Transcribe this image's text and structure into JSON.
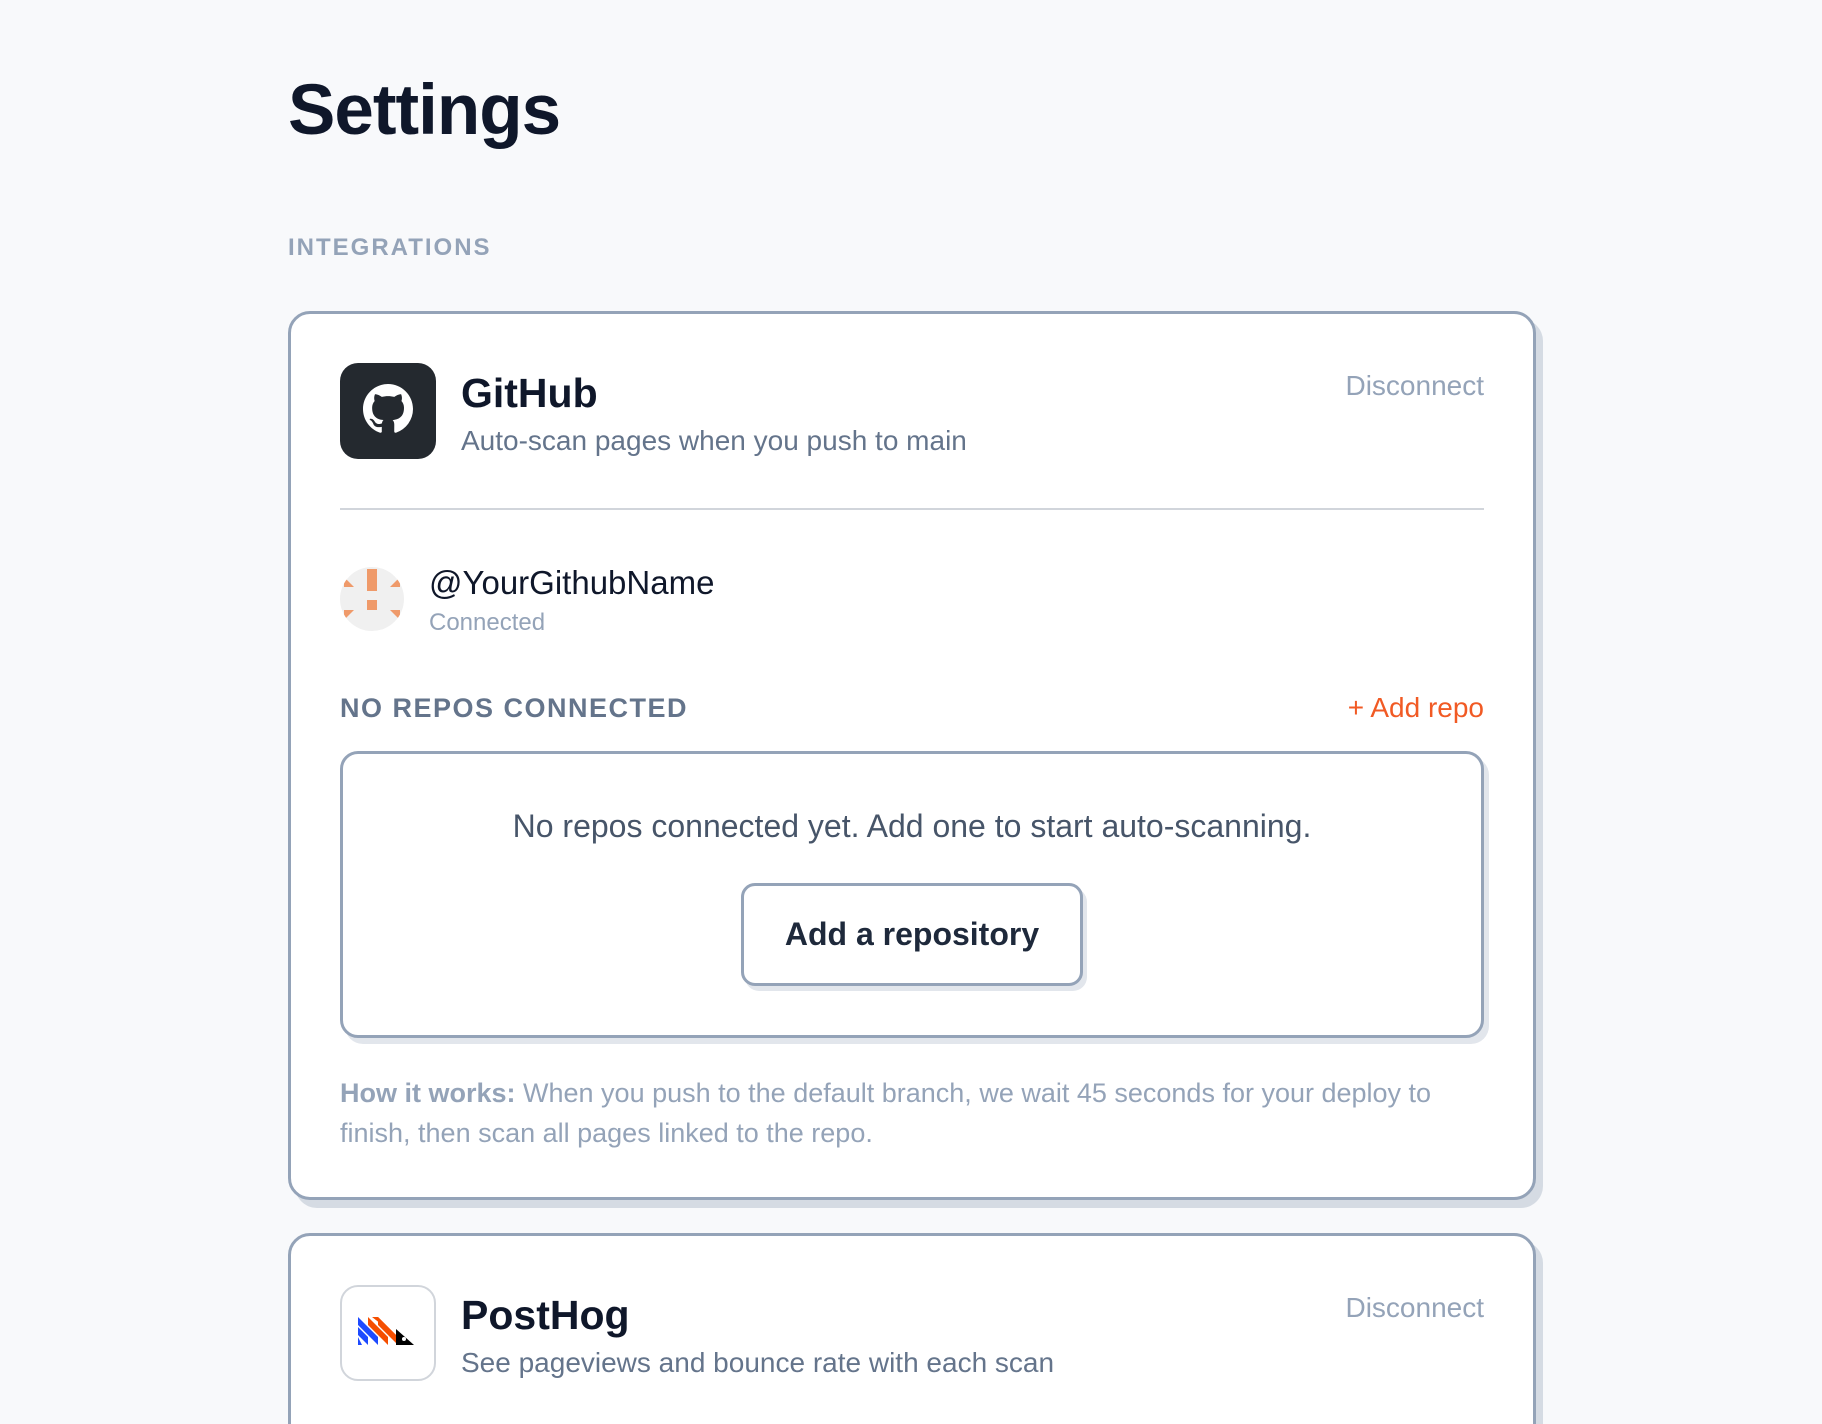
{
  "page": {
    "title": "Settings"
  },
  "section": {
    "label": "INTEGRATIONS"
  },
  "github": {
    "name": "GitHub",
    "description": "Auto-scan pages when you push to main",
    "disconnect_label": "Disconnect",
    "account": {
      "username": "@YourGithubName",
      "status": "Connected"
    },
    "repos": {
      "heading": "NO REPOS CONNECTED",
      "add_link": "+ Add repo",
      "empty_message": "No repos connected yet. Add one to start auto-scanning.",
      "add_button": "Add a repository"
    },
    "how_it_works": {
      "label": "How it works:",
      "text": " When you push to the default branch, we wait 45 seconds for your deploy to finish, then scan all pages linked to the repo."
    },
    "icon": "github-icon"
  },
  "posthog": {
    "name": "PostHog",
    "description": "See pageviews and bounce rate with each scan",
    "disconnect_label": "Disconnect",
    "icon": "posthog-logo-icon"
  },
  "colors": {
    "accent": "#f15a24",
    "border": "#94a3b8",
    "text_muted": "#94a3b8",
    "github_tile": "#24292f"
  }
}
